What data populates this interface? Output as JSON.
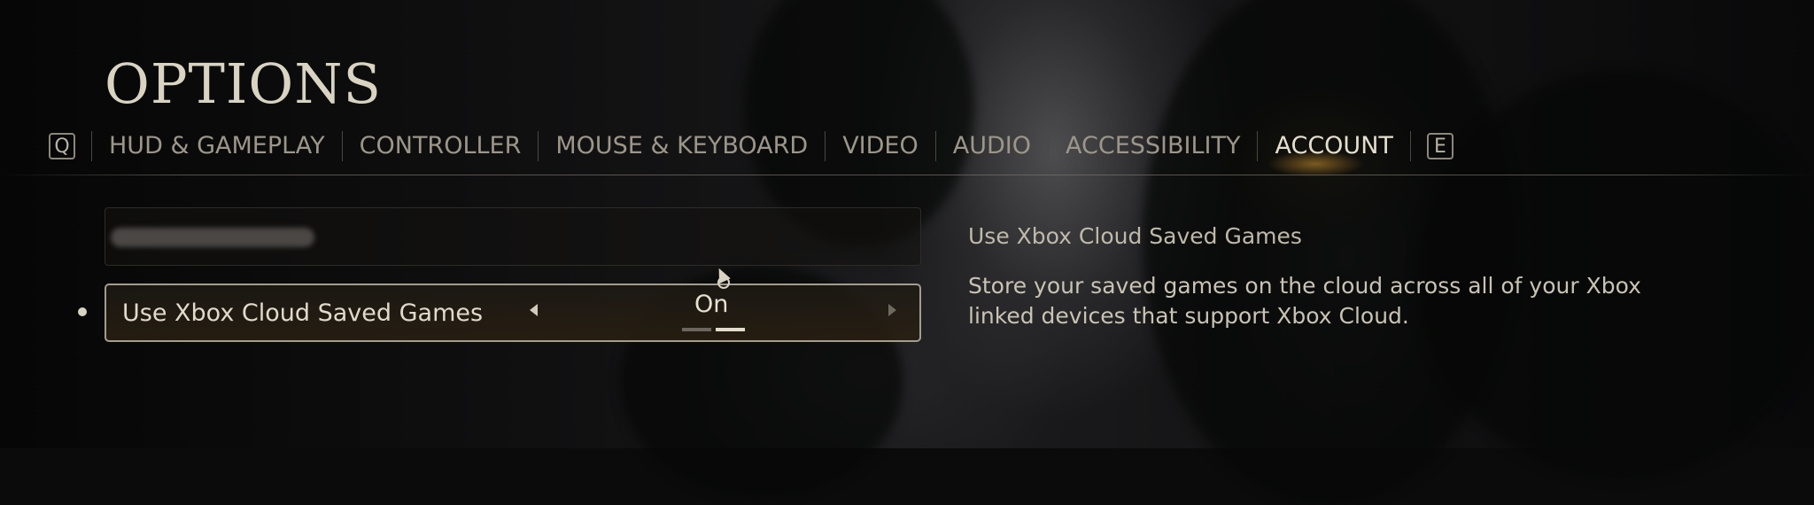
{
  "page": {
    "title": "OPTIONS"
  },
  "tabs": {
    "prev_key": "Q",
    "next_key": "E",
    "items": [
      {
        "label": "HUD & GAMEPLAY",
        "active": false
      },
      {
        "label": "CONTROLLER",
        "active": false
      },
      {
        "label": "MOUSE & KEYBOARD",
        "active": false
      },
      {
        "label": "VIDEO",
        "active": false
      },
      {
        "label": "AUDIO",
        "active": false
      },
      {
        "label": "ACCESSIBILITY",
        "active": false
      },
      {
        "label": "ACCOUNT",
        "active": true
      }
    ]
  },
  "settings": {
    "redacted_row": {
      "label": ""
    },
    "cloud_saves": {
      "label": "Use Xbox Cloud Saved Games",
      "value": "On",
      "selected_index": 1,
      "options_count": 2
    }
  },
  "description": {
    "title": "Use Xbox Cloud Saved Games",
    "body": "Store your saved games on the cloud across all of your Xbox linked devices that support Xbox Cloud."
  },
  "colors": {
    "text_primary": "#e0dacb",
    "text_muted": "#9c968a",
    "accent_glow": "#d29632",
    "border": "#a39d8f"
  },
  "icons": [
    "left-arrow-icon",
    "right-arrow-icon",
    "mouse-cursor-icon",
    "bullet-icon"
  ]
}
